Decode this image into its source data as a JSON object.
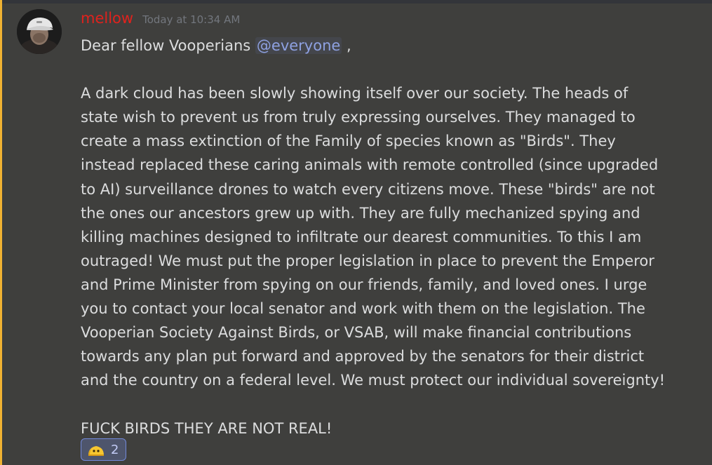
{
  "message": {
    "author": "mellow",
    "timestamp": "Today at 10:34 AM",
    "greeting_prefix": "Dear fellow Vooperians ",
    "mention": "@everyone",
    "greeting_suffix": " ,",
    "paragraph_lines": [
      "A dark cloud has been slowly showing itself over our society. The heads of",
      "state wish to prevent us from truly expressing ourselves. They managed to",
      "create a mass extinction of the Family of species known as \"Birds\". They",
      "instead replaced these caring animals with remote controlled (since upgraded",
      "to AI) surveillance drones to watch every citizens move. These \"birds\" are not",
      "the ones our ancestors grew up with. They are fully mechanized spying and",
      "killing machines designed to infiltrate our dearest communities. To this I am",
      "outraged! We must put the proper legislation in place to prevent the Emperor",
      "and Prime Minister from spying on our friends, family, and loved ones. I urge",
      "you to contact your local senator and work with them on the legislation. The",
      "Vooperian Society Against Birds, or VSAB, will make financial contributions",
      "towards any plan put forward and approved by the senators for their district",
      "and the country on a federal level. We must protect our individual sovereignty!"
    ],
    "closing": "FUCK BIRDS THEY ARE NOT REAL!",
    "reaction": {
      "emoji": "yellow-blob-emoji",
      "count": "2"
    }
  },
  "colors": {
    "background": "#3f3f3d",
    "username": "#e0221d",
    "mention": "#8ea1e1",
    "text": "#dcddde",
    "timestamp": "#72767d",
    "mention_bar": "#f0b232"
  }
}
